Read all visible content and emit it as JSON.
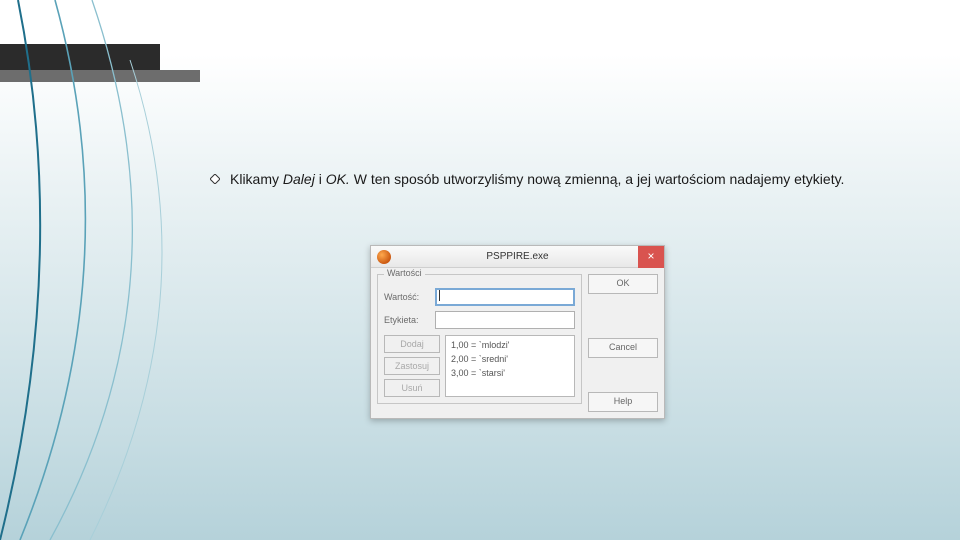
{
  "slide": {
    "bullet_prefix": "Klikamy ",
    "bullet_italic": "Dalej",
    "bullet_mid": " i ",
    "bullet_italic2": "OK.",
    "bullet_rest": " W ten sposób utworzyliśmy nową zmienną, a jej wartościom nadajemy etykiety."
  },
  "dialog": {
    "title": "PSPPIRE.exe",
    "close_glyph": "×",
    "group_title": "Wartości",
    "value_label": "Wartość:",
    "label_label": "Etykieta:",
    "value_field": "",
    "label_field": "",
    "btn_add": "Dodaj",
    "btn_apply": "Zastosuj",
    "btn_remove": "Usuń",
    "list": [
      "1,00 = `mlodzi'",
      "2,00 = `sredni'",
      "3,00 = `starsi'"
    ],
    "btn_ok": "OK",
    "btn_cancel": "Cancel",
    "btn_help": "Help"
  }
}
